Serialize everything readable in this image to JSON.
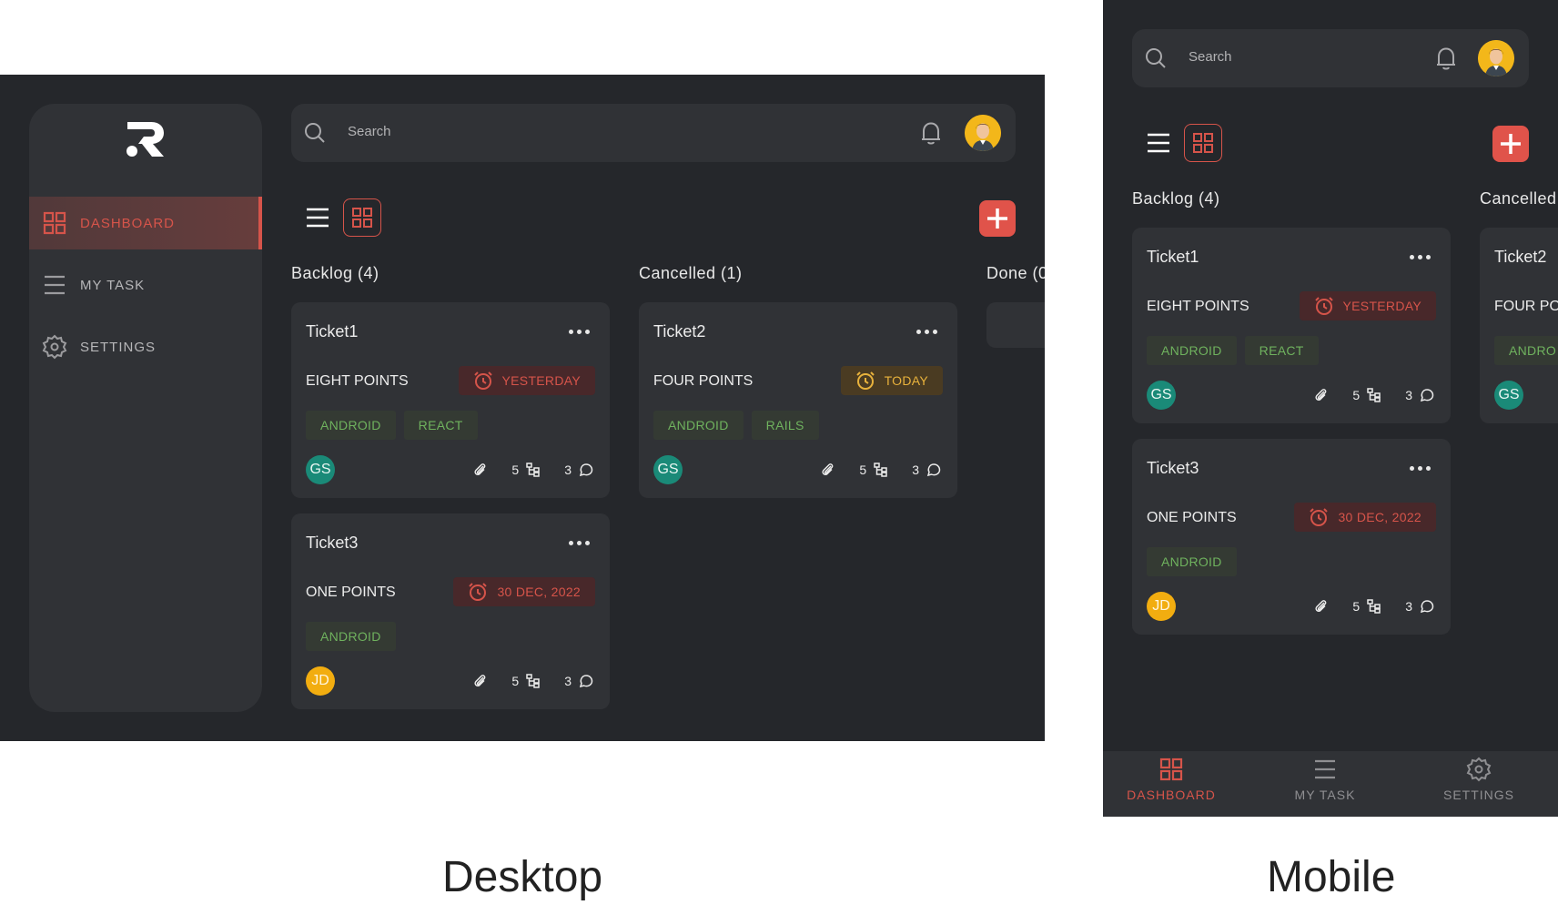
{
  "colors": {
    "accent": "#d6544a",
    "background": "#25272b",
    "surface": "#303236",
    "tag_text": "#6fb25e",
    "due_yellow": "#e8b23c"
  },
  "nav": [
    {
      "label": "DASHBOARD",
      "icon": "grid-icon",
      "active": true
    },
    {
      "label": "MY TASK",
      "icon": "list-icon",
      "active": false
    },
    {
      "label": "SETTINGS",
      "icon": "gear-icon",
      "active": false
    }
  ],
  "search": {
    "placeholder": "Search"
  },
  "columns": [
    {
      "title": "Backlog (4)"
    },
    {
      "title": "Cancelled (1)"
    },
    {
      "title": "Done (0"
    }
  ],
  "mobile_columns": [
    {
      "title": "Backlog (4)"
    },
    {
      "title": "Cancelled"
    }
  ],
  "cards": {
    "ticket1": {
      "title": "Ticket1",
      "points": "EIGHT POINTS",
      "due": "YESTERDAY",
      "tags": [
        "ANDROID",
        "REACT"
      ],
      "assignee": "GS",
      "subtasks": "5",
      "comments": "3"
    },
    "ticket2": {
      "title": "Ticket2",
      "points": "FOUR POINTS",
      "due": "TODAY",
      "tags": [
        "ANDROID",
        "RAILS"
      ],
      "assignee": "GS",
      "subtasks": "5",
      "comments": "3"
    },
    "ticket3": {
      "title": "Ticket3",
      "points": "ONE POINTS",
      "due": "30 DEC, 2022",
      "tags": [
        "ANDROID"
      ],
      "assignee": "JD",
      "subtasks": "5",
      "comments": "3"
    }
  },
  "mobile_ticket2_partial": {
    "title": "Ticket2",
    "points": "FOUR PO",
    "tag": "ANDRO",
    "assignee": "GS"
  },
  "captions": {
    "desktop": "Desktop",
    "mobile": "Mobile"
  }
}
